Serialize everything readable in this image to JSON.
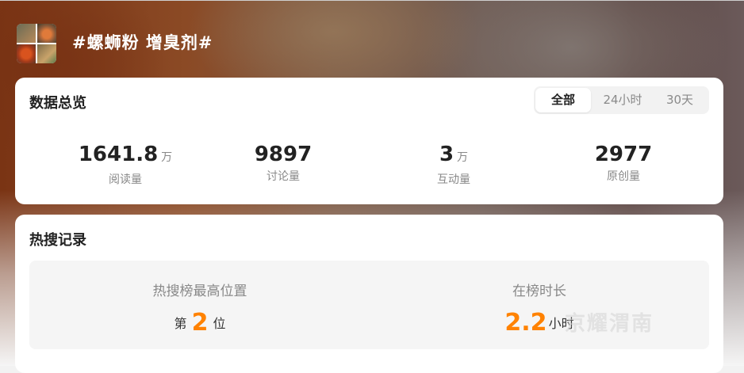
{
  "topic": {
    "title": "#螺蛳粉 增臭剂#",
    "thumbnail_icon": "topic-collage-image"
  },
  "overview": {
    "title": "数据总览",
    "tabs": [
      {
        "label": "全部",
        "active": true
      },
      {
        "label": "24小时",
        "active": false
      },
      {
        "label": "30天",
        "active": false
      }
    ],
    "stats": [
      {
        "value": "1641.8",
        "unit": "万",
        "label": "阅读量"
      },
      {
        "value": "9897",
        "unit": "",
        "label": "讨论量"
      },
      {
        "value": "3",
        "unit": "万",
        "label": "互动量"
      },
      {
        "value": "2977",
        "unit": "",
        "label": "原创量"
      }
    ]
  },
  "hot_search": {
    "title": "热搜记录",
    "highest_position": {
      "label": "热搜榜最高位置",
      "prefix": "第",
      "value": "2",
      "suffix": "位"
    },
    "duration": {
      "label": "在榜时长",
      "value": "2.2",
      "unit": "小时"
    }
  },
  "watermark": {
    "text": "京耀渭南"
  },
  "colors": {
    "accent": "#ff8200",
    "card_bg": "#ffffff",
    "muted_text": "#888888"
  }
}
